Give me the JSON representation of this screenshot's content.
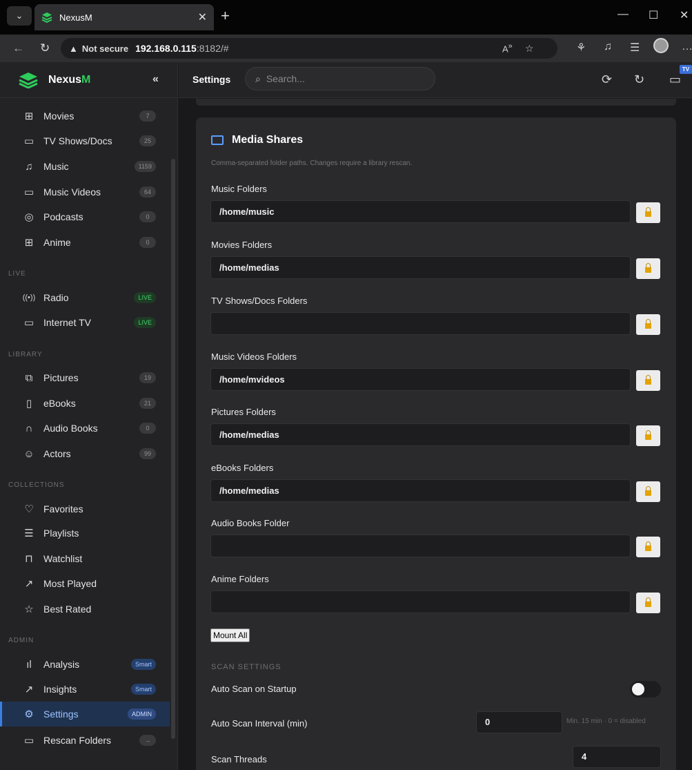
{
  "browser": {
    "tab_title": "NexusM",
    "security": "Not secure",
    "url_host": "192.168.0.115",
    "url_rest": ":8182/#"
  },
  "app": {
    "brand_prefix": "Nexus",
    "brand_suffix": "M",
    "collapse_label": "«"
  },
  "sidebar": {
    "media": [
      {
        "label": "Movies",
        "badge": "7",
        "icon": "film-icon"
      },
      {
        "label": "TV Shows/Docs",
        "badge": "25",
        "icon": "tv-icon"
      },
      {
        "label": "Music",
        "badge": "1159",
        "icon": "music-icon"
      },
      {
        "label": "Music Videos",
        "badge": "64",
        "icon": "video-icon"
      },
      {
        "label": "Podcasts",
        "badge": "0",
        "icon": "podcast-icon"
      },
      {
        "label": "Anime",
        "badge": "0",
        "icon": "film-icon"
      }
    ],
    "live_header": "LIVE",
    "live": [
      {
        "label": "Radio",
        "badge": "LIVE",
        "icon": "radio-icon"
      },
      {
        "label": "Internet TV",
        "badge": "LIVE",
        "icon": "tv-icon"
      }
    ],
    "library_header": "LIBRARY",
    "library": [
      {
        "label": "Pictures",
        "badge": "19",
        "icon": "image-icon"
      },
      {
        "label": "eBooks",
        "badge": "21",
        "icon": "book-icon"
      },
      {
        "label": "Audio Books",
        "badge": "0",
        "icon": "headphones-icon"
      },
      {
        "label": "Actors",
        "badge": "99",
        "icon": "users-icon"
      }
    ],
    "collections_header": "COLLECTIONS",
    "collections": [
      {
        "label": "Favorites",
        "icon": "heart-icon"
      },
      {
        "label": "Playlists",
        "icon": "list-icon"
      },
      {
        "label": "Watchlist",
        "icon": "bookmark-icon"
      },
      {
        "label": "Most Played",
        "icon": "trending-icon"
      },
      {
        "label": "Best Rated",
        "icon": "star-icon"
      }
    ],
    "admin_header": "ADMIN",
    "admin": [
      {
        "label": "Analysis",
        "badge": "Smart",
        "icon": "bar-chart-icon"
      },
      {
        "label": "Insights",
        "badge": "Smart",
        "icon": "trending-icon"
      },
      {
        "label": "Settings",
        "badge": "ADMIN",
        "icon": "gear-icon"
      },
      {
        "label": "Rescan Folders",
        "badge": "→",
        "icon": "folder-icon"
      }
    ]
  },
  "header": {
    "title": "Settings",
    "search_placeholder": "Search..."
  },
  "media_shares": {
    "title": "Media Shares",
    "description": "Comma-separated folder paths. Changes require a library rescan.",
    "fields": [
      {
        "label": "Music Folders",
        "value": "/home/music"
      },
      {
        "label": "Movies Folders",
        "value": "/home/medias"
      },
      {
        "label": "TV Shows/Docs Folders",
        "value": ""
      },
      {
        "label": "Music Videos Folders",
        "value": "/home/mvideos"
      },
      {
        "label": "Pictures Folders",
        "value": "/home/medias"
      },
      {
        "label": "eBooks Folders",
        "value": "/home/medias"
      },
      {
        "label": "Audio Books Folder",
        "value": ""
      },
      {
        "label": "Anime Folders",
        "value": ""
      }
    ],
    "mount_all": "Mount All"
  },
  "scan_settings": {
    "header": "SCAN SETTINGS",
    "auto_scan_startup": {
      "label": "Auto Scan on Startup",
      "enabled": false
    },
    "auto_scan_interval": {
      "label": "Auto Scan Interval (min)",
      "value": "0",
      "hint": "Min. 15 min · 0 = disabled"
    },
    "scan_threads": {
      "label": "Scan Threads",
      "value": "4"
    }
  },
  "colors": {
    "accent": "#3d7fe0",
    "brand_green": "#2ecc5b",
    "live_green": "#3fd56a"
  }
}
